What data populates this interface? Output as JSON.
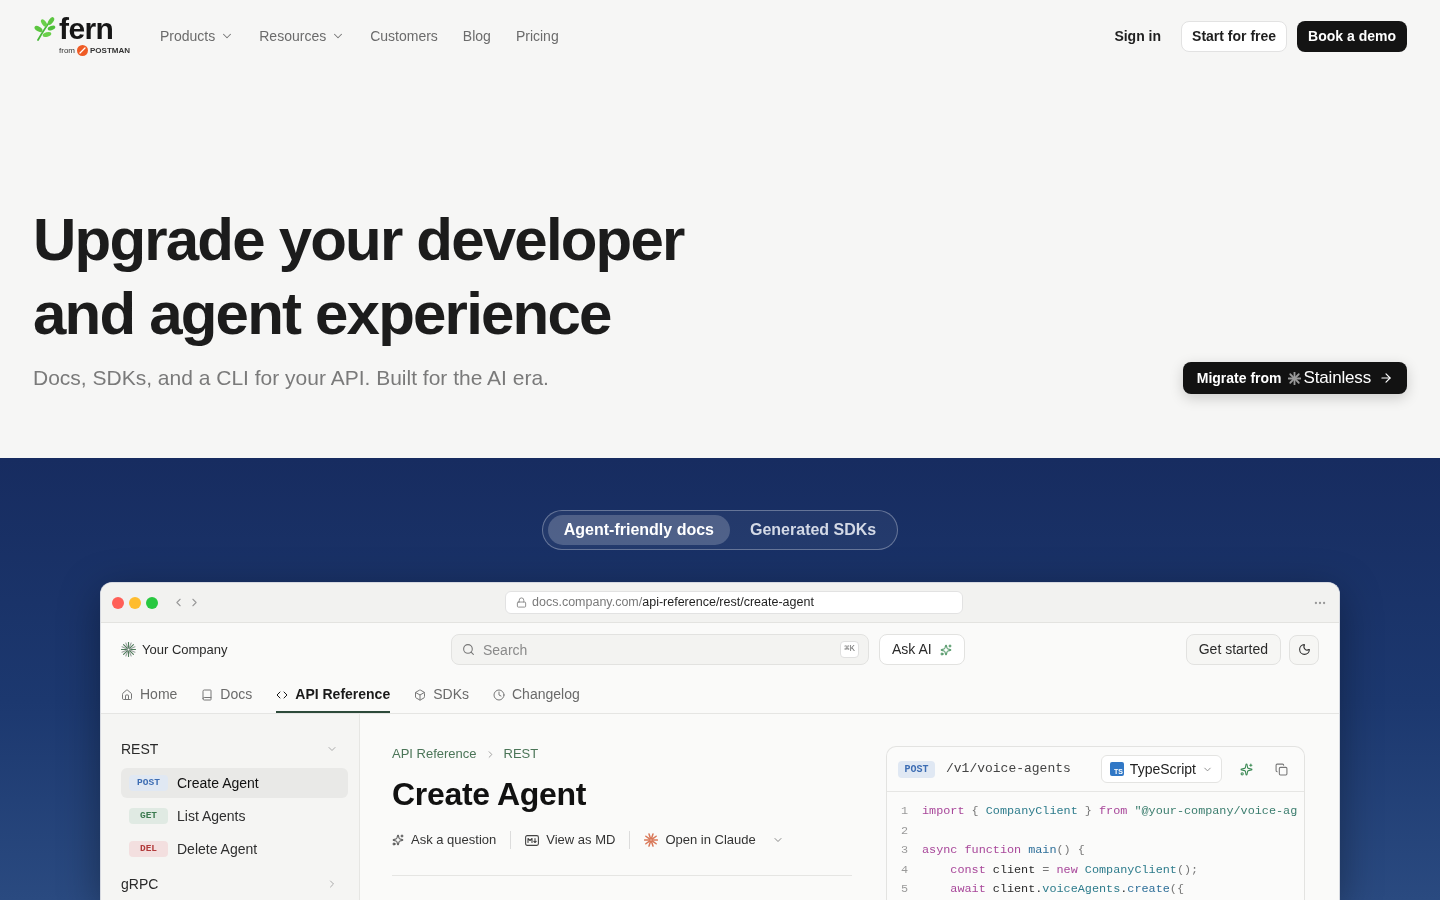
{
  "header": {
    "logo": {
      "wordmark": "fern",
      "byline": "from",
      "partner": "POSTMAN"
    },
    "nav": [
      {
        "label": "Products",
        "dropdown": true
      },
      {
        "label": "Resources",
        "dropdown": true
      },
      {
        "label": "Customers",
        "dropdown": false
      },
      {
        "label": "Blog",
        "dropdown": false
      },
      {
        "label": "Pricing",
        "dropdown": false
      }
    ],
    "actions": [
      {
        "label": "Sign in",
        "kind": "link"
      },
      {
        "label": "Start for free",
        "kind": "outline"
      },
      {
        "label": "Book a demo",
        "kind": "solid"
      }
    ]
  },
  "hero": {
    "heading_lines": [
      "Upgrade your developer",
      "and agent experience"
    ],
    "subtitle": "Docs, SDKs, and a CLI for your API. Built for the AI era.",
    "migrate_button": {
      "label": "Migrate from",
      "brand": "Stainless"
    }
  },
  "showcase": {
    "tabs": [
      {
        "label": "Agent-friendly docs",
        "selected": true
      },
      {
        "label": "Generated SDKs",
        "selected": false
      }
    ],
    "browser": {
      "url": {
        "host": "docs.company.com/",
        "path": "api-reference/rest/create-agent"
      },
      "docs": {
        "site_name": "Your Company",
        "search": {
          "placeholder": "Search",
          "shortcut": "⌘K"
        },
        "ask_ai": "Ask AI",
        "get_started": "Get started",
        "tabs": [
          {
            "kind": "home",
            "label": "Home",
            "selected": false
          },
          {
            "kind": "guide",
            "label": "Docs",
            "selected": false
          },
          {
            "kind": "reference",
            "label": "API Reference",
            "selected": true
          },
          {
            "kind": "sdk",
            "label": "SDKs",
            "selected": false
          },
          {
            "kind": "changelog",
            "label": "Changelog",
            "selected": false
          }
        ],
        "sidebar": [
          {
            "label": "REST",
            "expanded": true,
            "children": [
              {
                "method": "POST",
                "color": "#3d6db3",
                "label": "Create Agent",
                "selected": true
              },
              {
                "method": "GET",
                "color": "#3b7a4f",
                "label": "List Agents",
                "selected": false
              },
              {
                "method": "DEL",
                "color": "#b23a3a",
                "label": "Delete Agent",
                "selected": false
              }
            ]
          },
          {
            "label": "gRPC",
            "expanded": false
          }
        ],
        "breadcrumb": [
          "API Reference",
          "REST"
        ],
        "title": "Create Agent",
        "page_actions": [
          {
            "kind": "ask",
            "label": "Ask a question",
            "dropdown": false
          },
          {
            "kind": "markdown",
            "label": "View as MD",
            "dropdown": false
          },
          {
            "kind": "claude",
            "label": "Open in Claude",
            "dropdown": true
          }
        ],
        "code_panel": {
          "method": "POST",
          "color": "#3d6db3",
          "path": "/v1/voice-agents",
          "language": {
            "badge": "TS",
            "label": "TypeScript"
          },
          "lines": [
            {
              "number": "1",
              "tokens": [
                {
                  "text": "import",
                  "kind": "kw"
                },
                {
                  "text": " { ",
                  "kind": "punct"
                },
                {
                  "text": "CompanyClient",
                  "kind": "type"
                },
                {
                  "text": " } ",
                  "kind": "punct"
                },
                {
                  "text": "from",
                  "kind": "kw"
                },
                {
                  "text": " \"@your-company/voice-ag",
                  "kind": "str"
                }
              ]
            },
            {
              "number": "2"
            },
            {
              "number": "3",
              "tokens": [
                {
                  "text": "async",
                  "kind": "kw"
                },
                {
                  "text": " function",
                  "kind": "kw"
                },
                {
                  "text": " main",
                  "kind": "fn"
                },
                {
                  "text": "() {",
                  "kind": "punct"
                }
              ]
            },
            {
              "number": "4",
              "tokens": [
                {
                  "text": "    const",
                  "kind": "kw"
                },
                {
                  "text": " client ",
                  "kind": "plain"
                },
                {
                  "text": "= ",
                  "kind": "punct"
                },
                {
                  "text": "new",
                  "kind": "kw"
                },
                {
                  "text": " CompanyClient",
                  "kind": "type"
                },
                {
                  "text": "();",
                  "kind": "punct"
                }
              ]
            },
            {
              "number": "5",
              "tokens": [
                {
                  "text": "    await",
                  "kind": "kw"
                },
                {
                  "text": " client.",
                  "kind": "plain"
                },
                {
                  "text": "voiceAgents",
                  "kind": "prop"
                },
                {
                  "text": ".",
                  "kind": "plain"
                },
                {
                  "text": "create",
                  "kind": "fn"
                },
                {
                  "text": "({",
                  "kind": "punct"
                }
              ]
            }
          ]
        }
      }
    }
  }
}
